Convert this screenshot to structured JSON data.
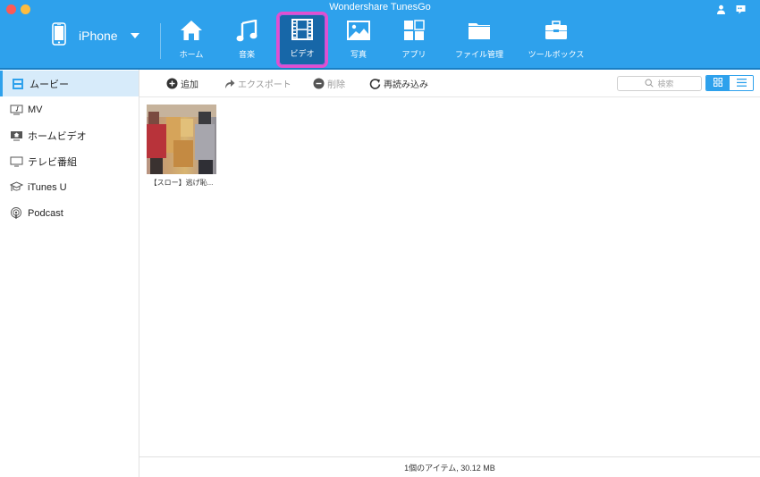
{
  "window": {
    "title": "Wondershare TunesGo"
  },
  "header": {
    "device_name": "iPhone",
    "icons": [
      "user-icon",
      "feedback-icon"
    ],
    "nav": [
      {
        "label": "ホーム",
        "icon": "home-icon",
        "active": false
      },
      {
        "label": "音楽",
        "icon": "music-icon",
        "active": false
      },
      {
        "label": "ビデオ",
        "icon": "film-icon",
        "active": true
      },
      {
        "label": "写真",
        "icon": "photo-icon",
        "active": false
      },
      {
        "label": "アプリ",
        "icon": "apps-icon",
        "active": false
      },
      {
        "label": "ファイル管理",
        "icon": "folder-icon",
        "active": false
      },
      {
        "label": "ツールボックス",
        "icon": "toolbox-icon",
        "active": false
      }
    ]
  },
  "sidebar": {
    "items": [
      {
        "label": "ムービー",
        "icon": "movie-icon",
        "active": true
      },
      {
        "label": "MV",
        "icon": "music-video-icon",
        "active": false
      },
      {
        "label": "ホームビデオ",
        "icon": "home-video-icon",
        "active": false
      },
      {
        "label": "テレビ番組",
        "icon": "tv-icon",
        "active": false
      },
      {
        "label": "iTunes U",
        "icon": "graduation-cap-icon",
        "active": false
      },
      {
        "label": "Podcast",
        "icon": "podcast-icon",
        "active": false
      }
    ]
  },
  "toolbar": {
    "add_label": "追加",
    "export_label": "エクスポート",
    "delete_label": "削除",
    "refresh_label": "再読み込み",
    "search_placeholder": "検索",
    "view_mode": "grid"
  },
  "content": {
    "items": [
      {
        "label": "【スロー】逃げ恥..."
      }
    ]
  },
  "status": {
    "text": "1個のアイテム, 30.12 MB"
  },
  "colors": {
    "accent": "#2ea1ec",
    "selected_border": "#e24fd0",
    "selected_bg": "#1767a8"
  }
}
